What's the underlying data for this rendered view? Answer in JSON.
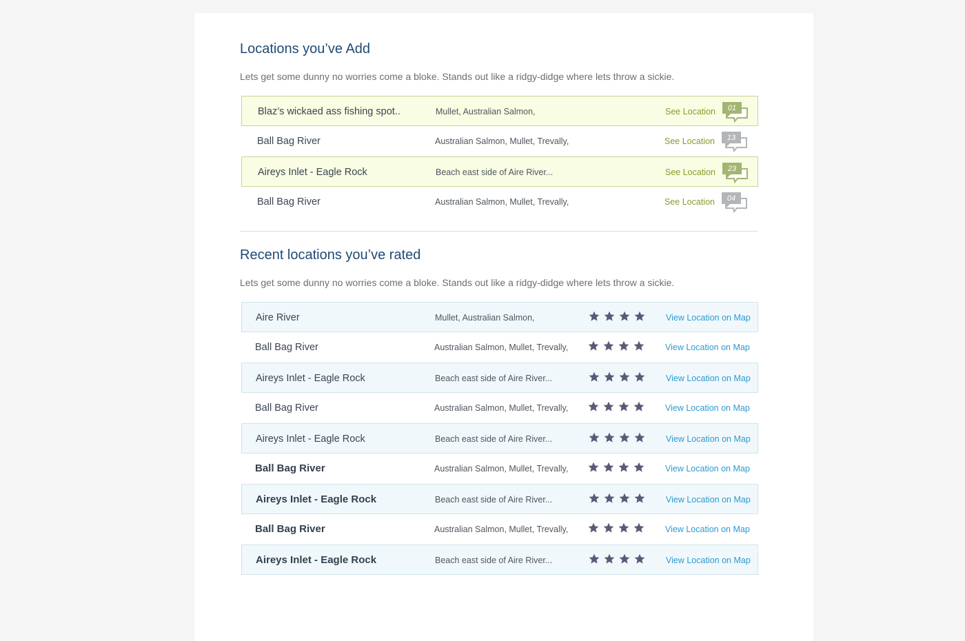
{
  "added": {
    "title": "Locations you’ve Add",
    "description": "Lets get some dunny no worries come a bloke. Stands out like a ridgy-didge where lets throw a sickie.",
    "rows": [
      {
        "name": "Blaz’s wickaed ass fishing spot..",
        "species": "Mullet, Australian Salmon,",
        "link": "See Location",
        "count": "01",
        "highlight": true
      },
      {
        "name": "Ball Bag River",
        "species": "Australian Salmon, Mullet, Trevally,",
        "link": "See Location",
        "count": "13",
        "highlight": false
      },
      {
        "name": "Aireys Inlet - Eagle Rock",
        "species": "Beach east side of Aire River...",
        "link": "See Location",
        "count": "23",
        "highlight": true
      },
      {
        "name": "Ball Bag River",
        "species": "Australian Salmon, Mullet, Trevally,",
        "link": "See Location",
        "count": "04",
        "highlight": false
      }
    ]
  },
  "rated": {
    "title": "Recent locations you’ve rated",
    "description": "Lets get some dunny no worries come a bloke. Stands out like a ridgy-didge where lets throw a sickie.",
    "rows": [
      {
        "name": "Aire River",
        "species": "Mullet, Australian Salmon,",
        "rating": 4,
        "link": "View Location on Map",
        "highlight": true,
        "bold": false
      },
      {
        "name": "Ball Bag River",
        "species": "Australian Salmon, Mullet, Trevally,",
        "rating": 4,
        "link": "View Location on Map",
        "highlight": false,
        "bold": false
      },
      {
        "name": "Aireys Inlet - Eagle Rock",
        "species": "Beach east side of Aire River...",
        "rating": 4,
        "link": "View Location on Map",
        "highlight": true,
        "bold": false
      },
      {
        "name": "Ball Bag River",
        "species": "Australian Salmon, Mullet, Trevally,",
        "rating": 4,
        "link": "View Location on Map",
        "highlight": false,
        "bold": false
      },
      {
        "name": "Aireys Inlet - Eagle Rock",
        "species": "Beach east side of Aire River...",
        "rating": 4,
        "link": "View Location on Map",
        "highlight": true,
        "bold": false
      },
      {
        "name": "Ball Bag River",
        "species": "Australian Salmon, Mullet, Trevally,",
        "rating": 4,
        "link": "View Location on Map",
        "highlight": false,
        "bold": true
      },
      {
        "name": "Aireys Inlet - Eagle Rock",
        "species": "Beach east side of Aire River...",
        "rating": 4,
        "link": "View Location on Map",
        "highlight": true,
        "bold": true
      },
      {
        "name": "Ball Bag River",
        "species": "Australian Salmon, Mullet, Trevally,",
        "rating": 4,
        "link": "View Location on Map",
        "highlight": false,
        "bold": true
      },
      {
        "name": "Aireys Inlet - Eagle Rock",
        "species": "Beach east side of Aire River...",
        "rating": 4,
        "link": "View Location on Map",
        "highlight": true,
        "bold": true
      }
    ]
  },
  "colors": {
    "bubble_active": "#a3b572",
    "bubble_inactive": "#b3b6b9",
    "star": "#5a5a78"
  },
  "icons": {
    "count_bubble": "speech-bubble-icon",
    "rating_star": "star-icon"
  }
}
